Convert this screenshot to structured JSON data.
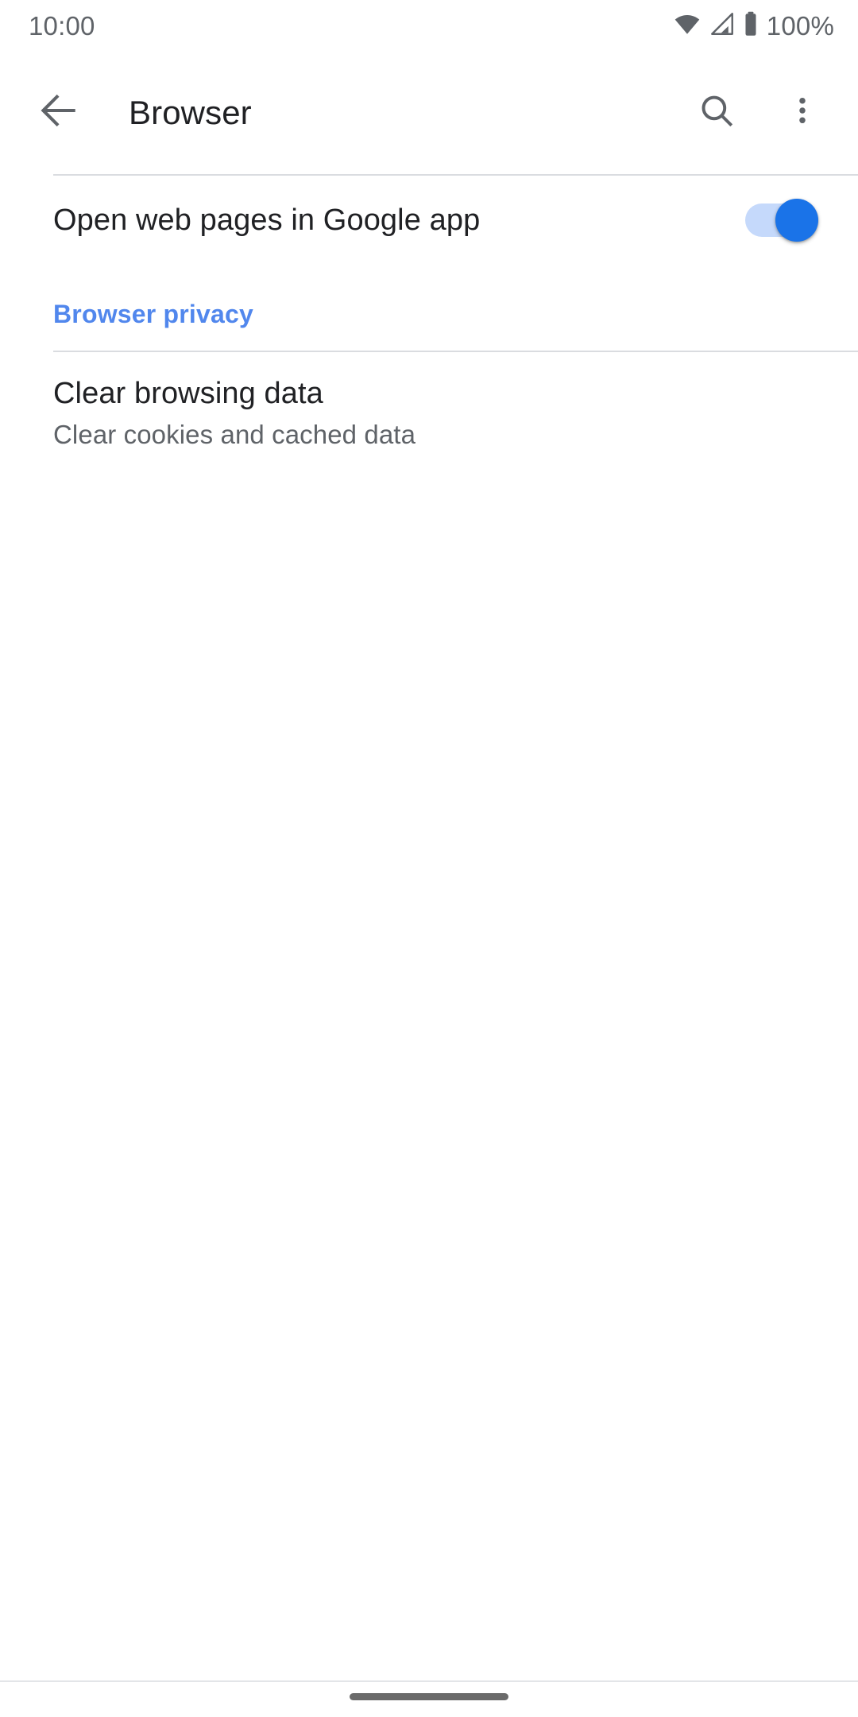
{
  "status_bar": {
    "clock": "10:00",
    "battery_percent": "100%",
    "icons": [
      "wifi-icon",
      "cell-signal-icon",
      "battery-icon"
    ]
  },
  "app_bar": {
    "back_label": "back-arrow-icon",
    "title": "Browser",
    "search_label": "search-icon",
    "overflow_label": "more-options-icon"
  },
  "settings": {
    "open_web_pages": {
      "title": "Open web pages in Google app",
      "switch_state": "on"
    },
    "browser_privacy_header": "Browser privacy",
    "clear_browsing_data": {
      "title": "Clear browsing data",
      "summary": "Clear cookies and cached data"
    }
  },
  "nav_bar": {
    "gesture_pill": "home-gesture-pill"
  },
  "colors": {
    "accent_blue": "#1a73e8",
    "section_header_blue": "#5187ed",
    "switch_track": "#c5d9fb",
    "primary_text": "#202124",
    "secondary_text": "#5f6368",
    "divider": "#dadce0",
    "background": "#ffffff"
  }
}
